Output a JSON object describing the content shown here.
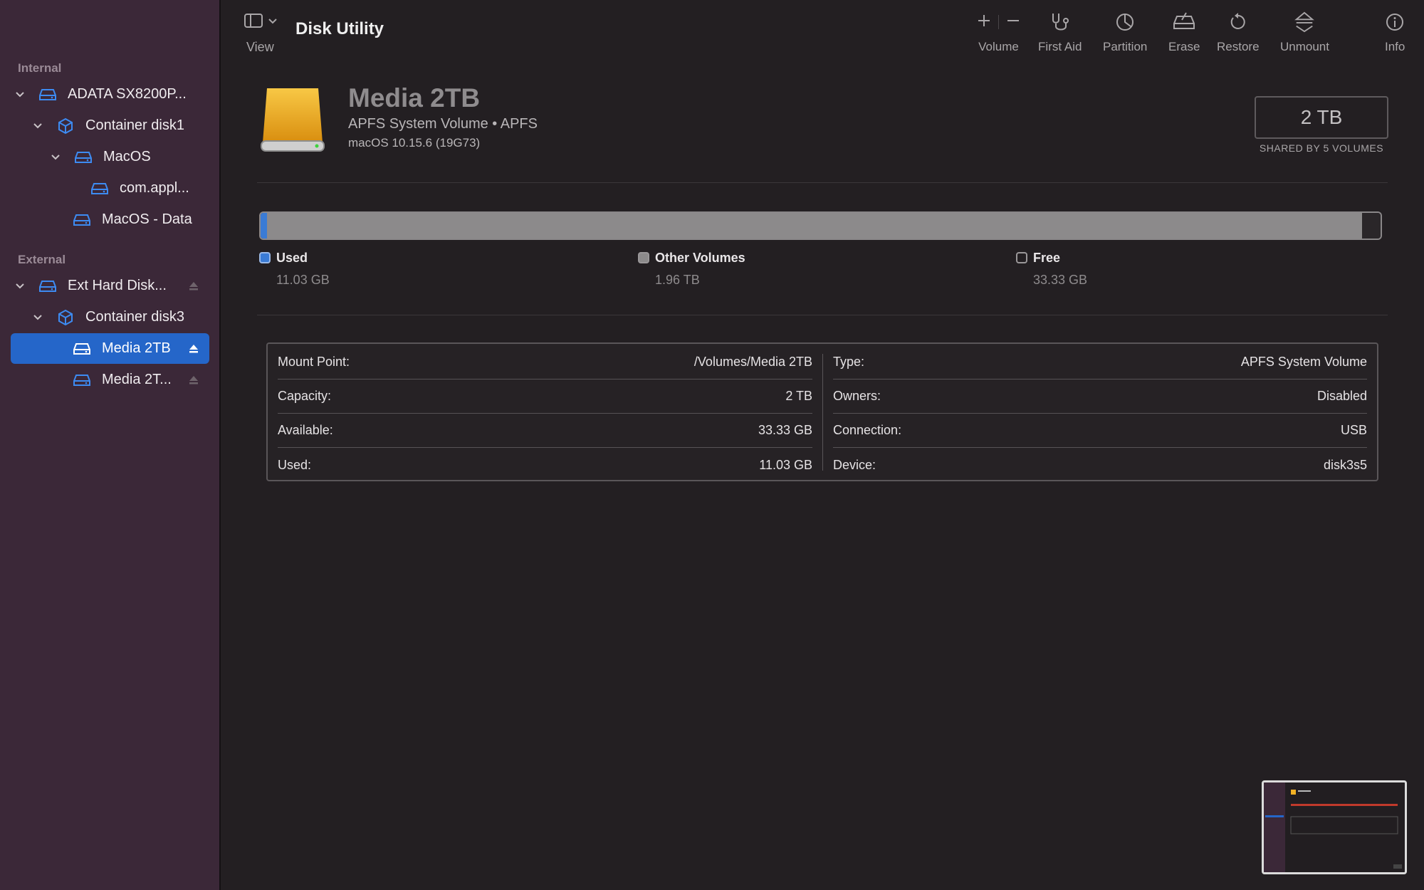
{
  "app": {
    "title": "Disk Utility"
  },
  "sidebar": {
    "sections": {
      "internal": "Internal",
      "external": "External"
    },
    "items": [
      {
        "label": "ADATA SX8200P...",
        "kind": "drive",
        "level": 0,
        "expanded": true
      },
      {
        "label": "Container disk1",
        "kind": "container",
        "level": 1,
        "expanded": true
      },
      {
        "label": "MacOS",
        "kind": "volume",
        "level": 2,
        "expanded": true
      },
      {
        "label": "com.appl...",
        "kind": "volume",
        "level": 3
      },
      {
        "label": "MacOS - Data",
        "kind": "volume",
        "level": 2
      },
      {
        "label": "Ext Hard Disk...",
        "kind": "drive",
        "level": 0,
        "expanded": true,
        "eject": true
      },
      {
        "label": "Container disk3",
        "kind": "container",
        "level": 1,
        "expanded": true
      },
      {
        "label": "Media 2TB",
        "kind": "volume",
        "level": 2,
        "eject": true,
        "selected": true
      },
      {
        "label": "Media 2T...",
        "kind": "volume",
        "level": 2,
        "eject": true
      }
    ]
  },
  "toolbar": {
    "view_label": "View",
    "volume_label": "Volume",
    "first_aid_label": "First Aid",
    "partition_label": "Partition",
    "erase_label": "Erase",
    "restore_label": "Restore",
    "unmount_label": "Unmount",
    "info_label": "Info"
  },
  "volume": {
    "name": "Media 2TB",
    "subtitle": "APFS System Volume • APFS",
    "os": "macOS 10.15.6 (19G73)",
    "capacity": "2 TB",
    "capacity_caption": "SHARED BY 5 VOLUMES"
  },
  "usage": {
    "used": {
      "label": "Used",
      "value": "11.03 GB",
      "fraction": 0.0055,
      "color": "#3a7bd5"
    },
    "other": {
      "label": "Other Volumes",
      "value": "1.96 TB",
      "fraction": 0.978,
      "color": "#8c8a8b"
    },
    "free": {
      "label": "Free",
      "value": "33.33 GB",
      "fraction": 0.0165,
      "color": "#2a2629"
    }
  },
  "info": {
    "left": [
      {
        "label": "Mount Point:",
        "value": "/Volumes/Media 2TB"
      },
      {
        "label": "Capacity:",
        "value": "2 TB"
      },
      {
        "label": "Available:",
        "value": "33.33 GB"
      },
      {
        "label": "Used:",
        "value": "11.03 GB"
      }
    ],
    "right": [
      {
        "label": "Type:",
        "value": "APFS System Volume"
      },
      {
        "label": "Owners:",
        "value": "Disabled"
      },
      {
        "label": "Connection:",
        "value": "USB"
      },
      {
        "label": "Device:",
        "value": "disk3s5"
      }
    ]
  },
  "colors": {
    "sidebar_bg": "#3b2838",
    "main_bg": "#231f22",
    "selection": "#2566c9",
    "icon_blue": "#3d8bf2",
    "drive_gold": "#f2b125"
  }
}
